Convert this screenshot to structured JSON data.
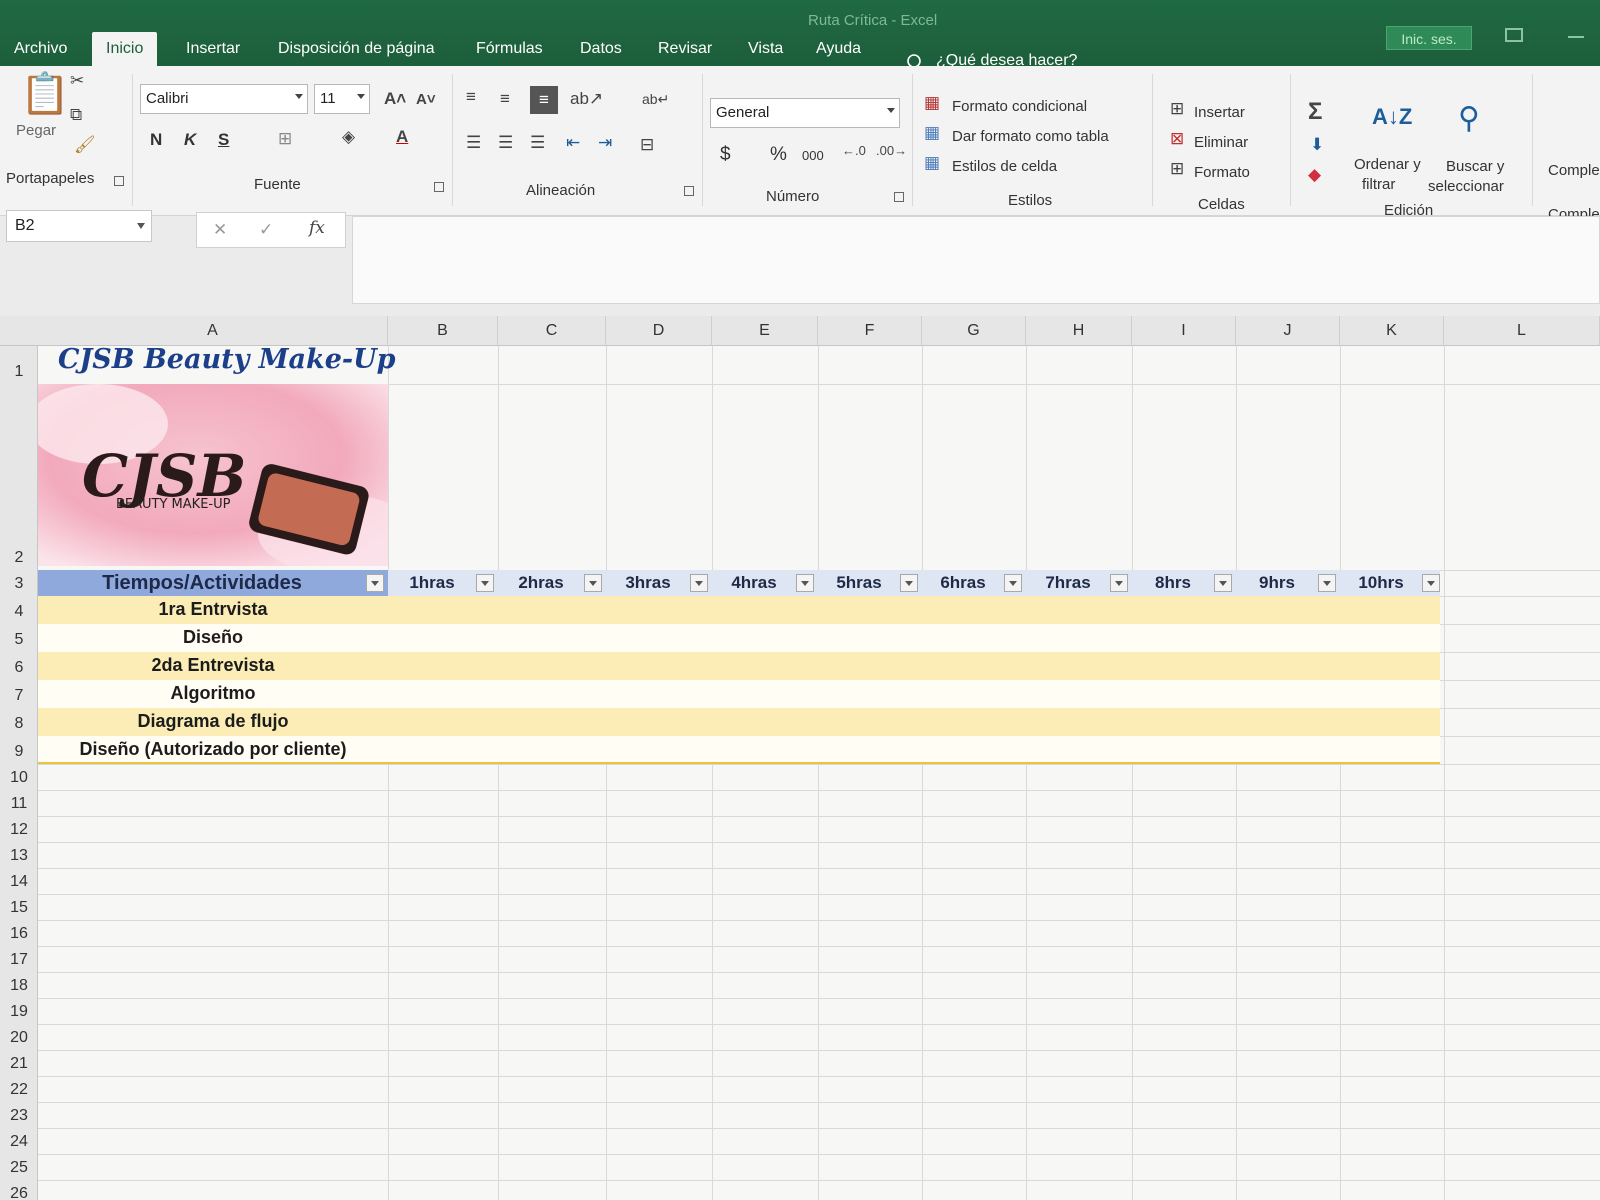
{
  "window": {
    "title": "Ruta Crítica  -  Excel",
    "signin": "Inic. ses."
  },
  "tabs": [
    "Archivo",
    "Inicio",
    "Insertar",
    "Disposición de página",
    "Fórmulas",
    "Datos",
    "Revisar",
    "Vista",
    "Ayuda"
  ],
  "active_tab": "Inicio",
  "tell_me": "¿Qué desea hacer?",
  "ribbon": {
    "portapapeles": {
      "label": "Portapapeles",
      "paste": "Pegar"
    },
    "fuente": {
      "label": "Fuente",
      "font_name": "Calibri",
      "font_size": "11",
      "bold": "N",
      "italic": "K",
      "underline": "S"
    },
    "alineacion": {
      "label": "Alineación"
    },
    "numero": {
      "label": "Número",
      "format": "General",
      "currency": "$",
      "percent": "%",
      "thousands": "000"
    },
    "estilos": {
      "label": "Estilos",
      "conditional": "Formato condicional",
      "as_table": "Dar formato como tabla",
      "cell_styles": "Estilos de celda"
    },
    "celdas": {
      "label": "Celdas",
      "insert": "Insertar",
      "delete": "Eliminar",
      "format": "Formato"
    },
    "edicion": {
      "label": "Edición",
      "sort_1": "Ordenar y",
      "sort_2": "filtrar",
      "find_1": "Buscar y",
      "find_2": "seleccionar"
    },
    "complementos": {
      "top": "Comple",
      "label": "Comple"
    }
  },
  "name_box": "B2",
  "columns": [
    "A",
    "B",
    "C",
    "D",
    "E",
    "F",
    "G",
    "H",
    "I",
    "J",
    "K",
    "L"
  ],
  "rows": [
    "1",
    "2",
    "3",
    "4",
    "5",
    "6",
    "7",
    "8",
    "9",
    "10",
    "11",
    "12",
    "13",
    "14",
    "15",
    "16",
    "17",
    "18",
    "19",
    "20",
    "21",
    "22",
    "23",
    "24",
    "25",
    "26"
  ],
  "cells": {
    "A1": "CJSB Beauty Make-Up",
    "logo_text": "CJSB",
    "logo_sub": "BEAUTY MAKE-UP"
  },
  "table": {
    "headers": [
      "Tiempos/Actividades",
      "1hras",
      "2hras",
      "3hras",
      "4hras",
      "5hras",
      "6hras",
      "7hras",
      "8hrs",
      "9hrs",
      "10hrs"
    ],
    "activities": [
      "1ra Entrvista",
      "Diseño",
      "2da Entrevista",
      "Algoritmo",
      "Diagrama de flujo",
      "Diseño (Autorizado por cliente)"
    ]
  },
  "colors": {
    "header_fill": "#8fa9dc",
    "band_fill": "#fbedb5",
    "excel_green": "#217346"
  }
}
